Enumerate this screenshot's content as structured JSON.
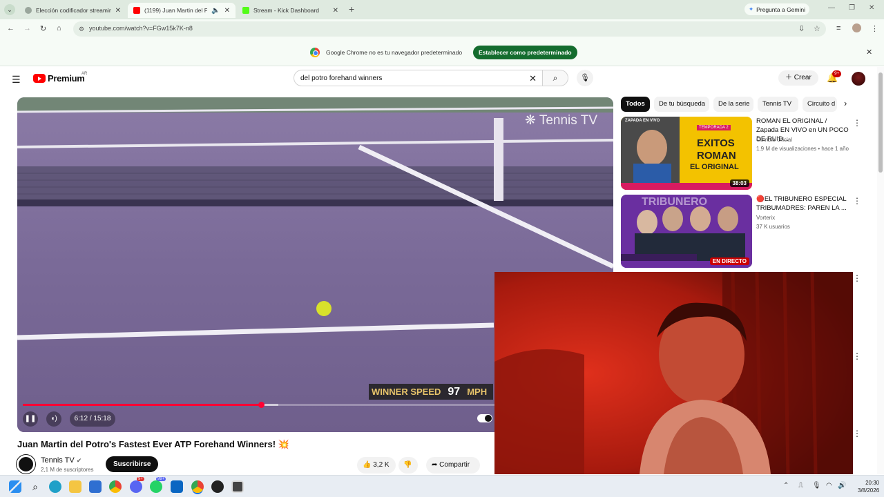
{
  "browser": {
    "tabs": [
      {
        "title": "Elección codificador streaming",
        "close": "✕"
      },
      {
        "title": "(1199) Juan Martin del Potr",
        "close": "✕"
      },
      {
        "title": "Stream - Kick Dashboard",
        "close": "✕"
      }
    ],
    "new_tab": "+",
    "gemini_label": "Pregunta a Gemini",
    "url": "youtube.com/watch?v=FGw15k7K-n8",
    "infobar_text": "Google Chrome no es tu navegador predeterminado",
    "set_default_label": "Establecer como predeterminado"
  },
  "youtube": {
    "logo_text": "Premium",
    "region": "AR",
    "search_query": "del potro forehand winners",
    "create_label": "Crear",
    "notif_count": "9+"
  },
  "player": {
    "watermark": "Tennis TV",
    "overlay_label": "WINNER SPEED",
    "overlay_value": "97",
    "overlay_unit": "MPH",
    "time": "6:12 / 15:18",
    "progress_played": 0.407,
    "progress_buffered": 0.437
  },
  "video": {
    "title": "Juan Martin del Potro's Fastest Ever ATP Forehand Winners!",
    "title_emoji": "💥",
    "channel": "Tennis TV",
    "subscribers": "2,1 M de suscriptores",
    "subscribe_label": "Suscribirse",
    "likes": "3,2 K",
    "share_label": "Compartir"
  },
  "sidebar": {
    "chips": [
      "Todos",
      "De tu búsqueda",
      "De la serie",
      "Tennis TV",
      "Circuito d"
    ],
    "recommendations": [
      {
        "title": "ROMAN EL ORIGINAL / Zapada EN VIVO en UN POCO DE RUID...",
        "channel": "Cumbia Oficial",
        "meta": "1,9 M de visualizaciones • hace 1 año",
        "duration": "38:03",
        "thumb_text": [
          "ZAPADA EN VIVO",
          "TEMPORADA 2",
          "EXITOS",
          "ROMAN",
          "EL ORIGINAL"
        ]
      },
      {
        "title": "🔴EL TRIBUNERO ESPECIAL TRIBUMADRES: PAREN LA ...",
        "channel": "Vorterix",
        "meta": "37 K usuarios",
        "live_label": "EN DIRECTO",
        "thumb_text": [
          "TRIBUNERO"
        ]
      }
    ]
  },
  "taskbar": {
    "time": "20:30",
    "date": "3/8/2026",
    "badge_1": "99+",
    "badge_2": "9+"
  }
}
